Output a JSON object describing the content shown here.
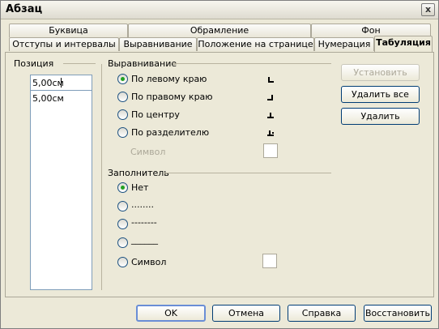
{
  "window": {
    "title": "Абзац",
    "close_label": "x"
  },
  "tabs_row1": [
    {
      "label": "Буквица"
    },
    {
      "label": "Обрамление"
    },
    {
      "label": "Фон"
    }
  ],
  "tabs_row2": [
    {
      "label": "Отступы и интервалы"
    },
    {
      "label": "Выравнивание"
    },
    {
      "label": "Положение на странице"
    },
    {
      "label": "Нумерация"
    },
    {
      "label": "Табуляция",
      "active": true
    }
  ],
  "position": {
    "heading": "Позиция",
    "input_value": "5,00см",
    "list": [
      "5,00см"
    ]
  },
  "alignment": {
    "heading": "Выравнивание",
    "options": [
      {
        "label": "По левому краю",
        "selected": true,
        "icon": "tab-left-icon"
      },
      {
        "label": "По правому краю",
        "selected": false,
        "icon": "tab-right-icon"
      },
      {
        "label": "По центру",
        "selected": false,
        "icon": "tab-center-icon"
      },
      {
        "label": "По разделителю",
        "selected": false,
        "icon": "tab-decimal-icon"
      }
    ],
    "symbol_label": "Символ"
  },
  "fill": {
    "heading": "Заполнитель",
    "options": [
      {
        "label": "Нет",
        "selected": true
      },
      {
        "label": "........",
        "selected": false
      },
      {
        "label": "--------",
        "selected": false
      },
      {
        "label": "______",
        "selected": false
      },
      {
        "label": "Символ",
        "selected": false
      }
    ]
  },
  "side_buttons": {
    "set": "Установить",
    "delete_all": "Удалить все",
    "delete": "Удалить"
  },
  "footer_buttons": {
    "ok": "OK",
    "cancel": "Отмена",
    "help": "Справка",
    "reset": "Восстановить"
  }
}
